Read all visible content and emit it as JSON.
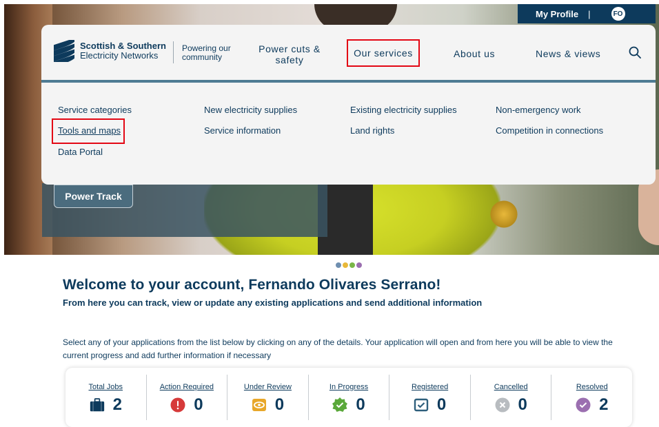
{
  "topbar": {
    "profile_label": "My Profile",
    "separator": "|",
    "avatar_initials": "FO"
  },
  "header": {
    "logo_line1": "Scottish & Southern",
    "logo_line2": "Electricity Networks",
    "tagline_line1": "Powering our",
    "tagline_line2": "community",
    "nav": {
      "power_line1": "Power cuts &",
      "power_line2": "safety",
      "services": "Our services",
      "about": "About us",
      "news": "News & views"
    }
  },
  "dropdown": {
    "service_categories": "Service categories",
    "tools_and_maps": "Tools and maps",
    "data_portal": "Data Portal",
    "new_supplies": "New electricity supplies",
    "service_information": "Service information",
    "existing_supplies": "Existing electricity supplies",
    "land_rights": "Land rights",
    "non_emergency": "Non-emergency work",
    "competition": "Competition in connections"
  },
  "hero": {
    "button_label": "Power Track",
    "carousel_dot_colors": [
      "#6f8fb0",
      "#e8b83a",
      "#7ab648",
      "#9b6fb0"
    ]
  },
  "welcome": {
    "title": "Welcome to your account, Fernando Olivares Serrano!",
    "subtitle": "From here you can track, view or update any existing applications and send additional information",
    "instructions": "Select any of your applications from the list below by clicking on any of the details. Your application will open and from here you will be able to view the current progress and add further information if necessary"
  },
  "stats": [
    {
      "label": "Total Jobs",
      "value": "2",
      "icon": "briefcase-icon",
      "color": "#0d3a5c"
    },
    {
      "label": "Action Required",
      "value": "0",
      "icon": "alert-icon",
      "color": "#d63a3a"
    },
    {
      "label": "Under Review",
      "value": "0",
      "icon": "eye-icon",
      "color": "#e8a72a"
    },
    {
      "label": "In Progress",
      "value": "0",
      "icon": "progress-badge-icon",
      "color": "#5aa83a"
    },
    {
      "label": "Registered",
      "value": "0",
      "icon": "registered-check-icon",
      "color": "#2e5f7c"
    },
    {
      "label": "Cancelled",
      "value": "0",
      "icon": "cancel-icon",
      "color": "#b8bcc0"
    },
    {
      "label": "Resolved",
      "value": "2",
      "icon": "resolved-check-icon",
      "color": "#9b6fb0"
    }
  ]
}
